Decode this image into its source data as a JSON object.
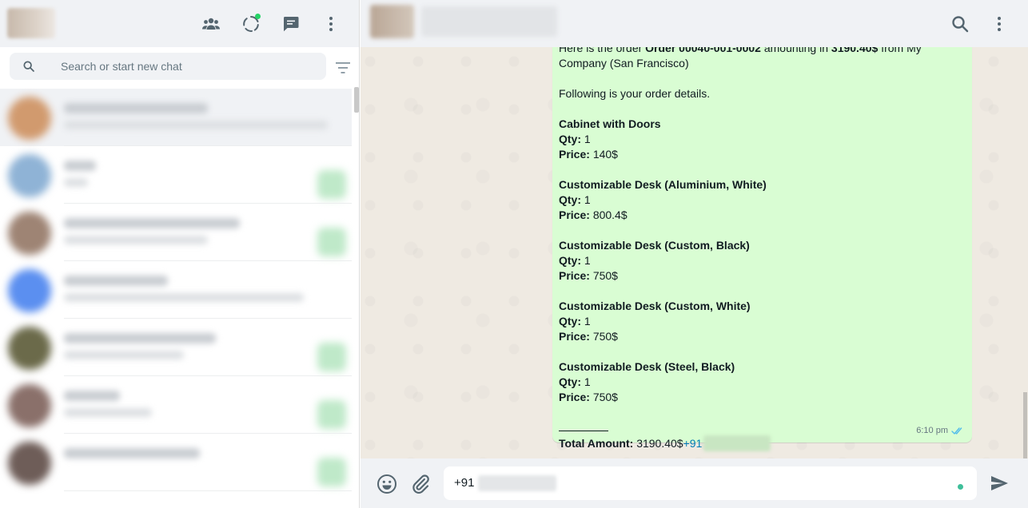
{
  "left_header": {
    "icons": [
      "communities-icon",
      "status-icon",
      "new-chat-icon",
      "menu-icon"
    ],
    "status_dot_color": "#25d366"
  },
  "search": {
    "placeholder": "Search or start new chat"
  },
  "chat_list": {
    "items": [
      {
        "avatar_color": "#d19a6e",
        "badge": false
      },
      {
        "avatar_color": "#8fb3d6",
        "badge": true
      },
      {
        "avatar_color": "#9e8474",
        "badge": true
      },
      {
        "avatar_color": "#5b8ff0",
        "badge": false
      },
      {
        "avatar_color": "#6b6a4a",
        "badge": true
      },
      {
        "avatar_color": "#8a706a",
        "badge": true
      },
      {
        "avatar_color": "#6e5d58",
        "badge": true
      }
    ]
  },
  "message": {
    "intro_pre": "Here is the order ",
    "order_ref": "Order 00040-001-0002",
    "intro_mid": " amounting in ",
    "amount": "3190.40$",
    "intro_post": " from My Company (San Francisco)",
    "following": "Following is your order details.",
    "items": [
      {
        "name": "Cabinet with Doors",
        "qty_label": "Qty:",
        "qty": "1",
        "price_label": "Price:",
        "price": "140$"
      },
      {
        "name": "Customizable Desk (Aluminium, White)",
        "qty_label": "Qty:",
        "qty": "1",
        "price_label": "Price:",
        "price": "800.4$"
      },
      {
        "name": "Customizable Desk (Custom, Black)",
        "qty_label": "Qty:",
        "qty": "1",
        "price_label": "Price:",
        "price": "750$"
      },
      {
        "name": "Customizable Desk (Custom, White)",
        "qty_label": "Qty:",
        "qty": "1",
        "price_label": "Price:",
        "price": "750$"
      },
      {
        "name": "Customizable Desk (Steel, Black)",
        "qty_label": "Qty:",
        "qty": "1",
        "price_label": "Price:",
        "price": "750$"
      }
    ],
    "total_label": "Total Amount:",
    "total_value": "3190.40$",
    "phone_prefix": "+91",
    "time": "6:10 pm",
    "bubble_color": "#d9fdd3",
    "tick_color": "#53bdeb"
  },
  "composer": {
    "prefix": "+91",
    "accent": "#3fbf9a"
  },
  "colors": {
    "header_bg": "#f0f2f5",
    "chat_bg": "#efeae2",
    "icon": "#54656f"
  }
}
